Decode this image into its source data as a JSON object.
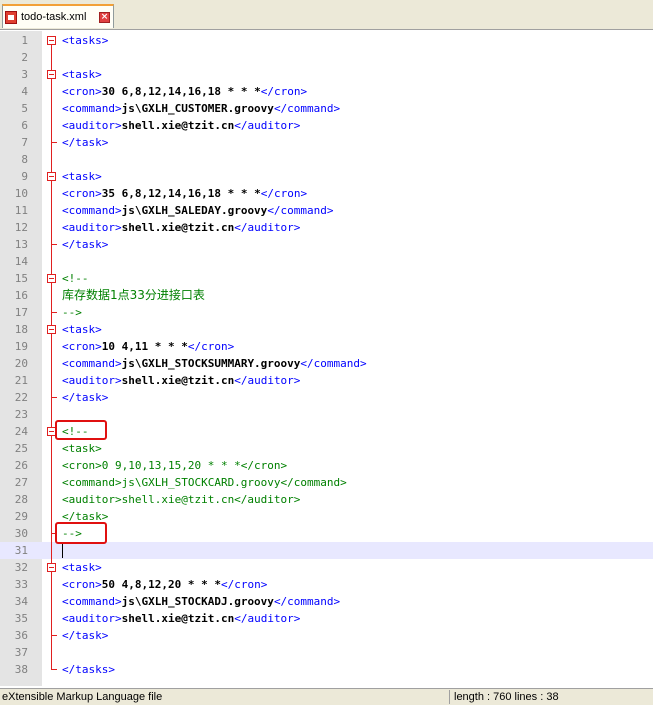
{
  "tab": {
    "filename": "todo-task.xml",
    "close_symbol": "×"
  },
  "status": {
    "file_type": "eXtensible Markup Language file",
    "length_label": "length : 760    lines : 38"
  },
  "editor": {
    "current_line": 31,
    "lines": [
      {
        "n": "1",
        "parts": [
          [
            "tag",
            "<tasks>"
          ]
        ]
      },
      {
        "n": "2",
        "parts": []
      },
      {
        "n": "3",
        "parts": [
          [
            "tag",
            "<task>"
          ]
        ]
      },
      {
        "n": "4",
        "parts": [
          [
            "tag",
            "<cron>"
          ],
          [
            "txt",
            "30 6,8,12,14,16,18 * * *"
          ],
          [
            "tag",
            "</cron>"
          ]
        ]
      },
      {
        "n": "5",
        "parts": [
          [
            "tag",
            "<command>"
          ],
          [
            "txt",
            "js\\GXLH_CUSTOMER.groovy"
          ],
          [
            "tag",
            "</command>"
          ]
        ]
      },
      {
        "n": "6",
        "parts": [
          [
            "tag",
            "<auditor>"
          ],
          [
            "txt",
            "shell.xie@tzit.cn"
          ],
          [
            "tag",
            "</auditor>"
          ]
        ]
      },
      {
        "n": "7",
        "parts": [
          [
            "tag",
            "</task>"
          ]
        ]
      },
      {
        "n": "8",
        "parts": []
      },
      {
        "n": "9",
        "parts": [
          [
            "tag",
            "<task>"
          ]
        ]
      },
      {
        "n": "10",
        "parts": [
          [
            "tag",
            "<cron>"
          ],
          [
            "txt",
            "35 6,8,12,14,16,18 * * *"
          ],
          [
            "tag",
            "</cron>"
          ]
        ]
      },
      {
        "n": "11",
        "parts": [
          [
            "tag",
            "<command>"
          ],
          [
            "txt",
            "js\\GXLH_SALEDAY.groovy"
          ],
          [
            "tag",
            "</command>"
          ]
        ]
      },
      {
        "n": "12",
        "parts": [
          [
            "tag",
            "<auditor>"
          ],
          [
            "txt",
            "shell.xie@tzit.cn"
          ],
          [
            "tag",
            "</auditor>"
          ]
        ]
      },
      {
        "n": "13",
        "parts": [
          [
            "tag",
            "</task>"
          ]
        ]
      },
      {
        "n": "14",
        "parts": []
      },
      {
        "n": "15",
        "parts": [
          [
            "cmt",
            "<!--"
          ]
        ]
      },
      {
        "n": "16",
        "parts": [
          [
            "cmt-cn",
            "库存数据1点33分进接口表"
          ]
        ]
      },
      {
        "n": "17",
        "parts": [
          [
            "cmt",
            "-->"
          ]
        ]
      },
      {
        "n": "18",
        "parts": [
          [
            "tag",
            "<task>"
          ]
        ]
      },
      {
        "n": "19",
        "parts": [
          [
            "tag",
            "<cron>"
          ],
          [
            "txt",
            "10 4,11 * * *"
          ],
          [
            "tag",
            "</cron>"
          ]
        ]
      },
      {
        "n": "20",
        "parts": [
          [
            "tag",
            "<command>"
          ],
          [
            "txt",
            "js\\GXLH_STOCKSUMMARY.groovy"
          ],
          [
            "tag",
            "</command>"
          ]
        ]
      },
      {
        "n": "21",
        "parts": [
          [
            "tag",
            "<auditor>"
          ],
          [
            "txt",
            "shell.xie@tzit.cn"
          ],
          [
            "tag",
            "</auditor>"
          ]
        ]
      },
      {
        "n": "22",
        "parts": [
          [
            "tag",
            "</task>"
          ]
        ]
      },
      {
        "n": "23",
        "parts": []
      },
      {
        "n": "24",
        "parts": [
          [
            "cmt",
            "<!--"
          ]
        ]
      },
      {
        "n": "25",
        "parts": [
          [
            "cmt",
            "<task>"
          ]
        ]
      },
      {
        "n": "26",
        "parts": [
          [
            "cmt",
            "<cron>0 9,10,13,15,20 * * *</cron>"
          ]
        ]
      },
      {
        "n": "27",
        "parts": [
          [
            "cmt",
            "<command>js\\GXLH_STOCKCARD.groovy</command>"
          ]
        ]
      },
      {
        "n": "28",
        "parts": [
          [
            "cmt",
            "<auditor>shell.xie@tzit.cn</auditor>"
          ]
        ]
      },
      {
        "n": "29",
        "parts": [
          [
            "cmt",
            "</task>"
          ]
        ]
      },
      {
        "n": "30",
        "parts": [
          [
            "cmt",
            "-->"
          ]
        ]
      },
      {
        "n": "31",
        "parts": []
      },
      {
        "n": "32",
        "parts": [
          [
            "tag",
            "<task>"
          ]
        ]
      },
      {
        "n": "33",
        "parts": [
          [
            "tag",
            "<cron>"
          ],
          [
            "txt",
            "50 4,8,12,20 * * *"
          ],
          [
            "tag",
            "</cron>"
          ]
        ]
      },
      {
        "n": "34",
        "parts": [
          [
            "tag",
            "<command>"
          ],
          [
            "txt",
            "js\\GXLH_STOCKADJ.groovy"
          ],
          [
            "tag",
            "</command>"
          ]
        ]
      },
      {
        "n": "35",
        "parts": [
          [
            "tag",
            "<auditor>"
          ],
          [
            "txt",
            "shell.xie@tzit.cn"
          ],
          [
            "tag",
            "</auditor>"
          ]
        ]
      },
      {
        "n": "36",
        "parts": [
          [
            "tag",
            "</task>"
          ]
        ]
      },
      {
        "n": "37",
        "parts": []
      },
      {
        "n": "38",
        "parts": [
          [
            "tag",
            "</tasks>"
          ]
        ]
      }
    ]
  }
}
